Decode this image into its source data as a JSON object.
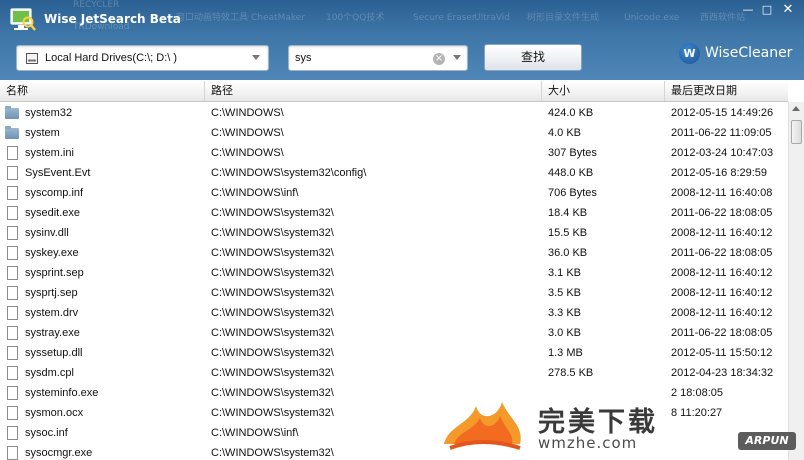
{
  "window": {
    "title": "Wise JetSearch Beta",
    "minimize_label": "—",
    "maximize_label": "□",
    "close_label": "✕"
  },
  "background_desktop_labels": [
    "RECYCLER",
    "TRDownload",
    "窗口动画特效工具",
    "CheatMaker",
    "100个QQ技术",
    "Secure Eraser",
    "UltraVid",
    "树形目录文件生成",
    "Unicode.exe",
    "西西软件站"
  ],
  "toolbar": {
    "drive_select": {
      "value": "Local Hard Drives(C:\\; D:\\ )",
      "icon": "hard-drive-icon"
    },
    "search": {
      "value": "sys",
      "clear_icon": "⊗"
    },
    "find_button_label": "查找",
    "brand": {
      "logo_letter": "W",
      "name": "WiseCleaner"
    }
  },
  "table": {
    "columns": [
      "名称",
      "路径",
      "大小",
      "最后更改日期"
    ],
    "rows": [
      {
        "icon": "folder-icon",
        "name": "system32",
        "path": "C:\\WINDOWS\\",
        "size": "424.0 KB",
        "date": "2012-05-15 14:49:26"
      },
      {
        "icon": "folder-icon",
        "name": "system",
        "path": "C:\\WINDOWS\\",
        "size": "4.0 KB",
        "date": "2011-06-22 11:09:05"
      },
      {
        "icon": "file-icon",
        "name": "system.ini",
        "path": "C:\\WINDOWS\\",
        "size": "307 Bytes",
        "date": "2012-03-24 10:47:03"
      },
      {
        "icon": "file-icon",
        "name": "SysEvent.Evt",
        "path": "C:\\WINDOWS\\system32\\config\\",
        "size": "448.0 KB",
        "date": "2012-05-16 8:29:59"
      },
      {
        "icon": "file-icon",
        "name": "syscomp.inf",
        "path": "C:\\WINDOWS\\inf\\",
        "size": "706 Bytes",
        "date": "2008-12-11 16:40:08"
      },
      {
        "icon": "file-icon",
        "name": "sysedit.exe",
        "path": "C:\\WINDOWS\\system32\\",
        "size": "18.4 KB",
        "date": "2011-06-22 18:08:05"
      },
      {
        "icon": "file-icon",
        "name": "sysinv.dll",
        "path": "C:\\WINDOWS\\system32\\",
        "size": "15.5 KB",
        "date": "2008-12-11 16:40:12"
      },
      {
        "icon": "file-icon",
        "name": "syskey.exe",
        "path": "C:\\WINDOWS\\system32\\",
        "size": "36.0 KB",
        "date": "2011-06-22 18:08:05"
      },
      {
        "icon": "file-icon",
        "name": "sysprint.sep",
        "path": "C:\\WINDOWS\\system32\\",
        "size": "3.1 KB",
        "date": "2008-12-11 16:40:12"
      },
      {
        "icon": "file-icon",
        "name": "sysprtj.sep",
        "path": "C:\\WINDOWS\\system32\\",
        "size": "3.5 KB",
        "date": "2008-12-11 16:40:12"
      },
      {
        "icon": "file-icon",
        "name": "system.drv",
        "path": "C:\\WINDOWS\\system32\\",
        "size": "3.3 KB",
        "date": "2008-12-11 16:40:12"
      },
      {
        "icon": "file-icon",
        "name": "systray.exe",
        "path": "C:\\WINDOWS\\system32\\",
        "size": "3.0 KB",
        "date": "2011-06-22 18:08:05"
      },
      {
        "icon": "file-icon",
        "name": "syssetup.dll",
        "path": "C:\\WINDOWS\\system32\\",
        "size": "1.3 MB",
        "date": "2012-05-11 15:50:12"
      },
      {
        "icon": "file-icon",
        "name": "sysdm.cpl",
        "path": "C:\\WINDOWS\\system32\\",
        "size": "278.5 KB",
        "date": "2012-04-23 18:34:32"
      },
      {
        "icon": "file-icon",
        "name": "systeminfo.exe",
        "path": "C:\\WINDOWS\\system32\\",
        "size": "",
        "date": "2 18:08:05"
      },
      {
        "icon": "file-icon",
        "name": "sysmon.ocx",
        "path": "C:\\WINDOWS\\system32\\",
        "size": "",
        "date": "8 11:20:27"
      },
      {
        "icon": "file-icon",
        "name": "sysoc.inf",
        "path": "C:\\WINDOWS\\inf\\",
        "size": "",
        "date": ""
      },
      {
        "icon": "file-icon",
        "name": "sysocmgr.exe",
        "path": "C:\\WINDOWS\\system32\\",
        "size": "",
        "date": ""
      }
    ]
  },
  "watermark": {
    "title": "完美下载",
    "site": "wmzhe.com",
    "badge": "ARPUN"
  },
  "colors": {
    "titlebar": "#3a6fa2",
    "accent": "#2b5f92",
    "folder": "#7c9fbd"
  }
}
